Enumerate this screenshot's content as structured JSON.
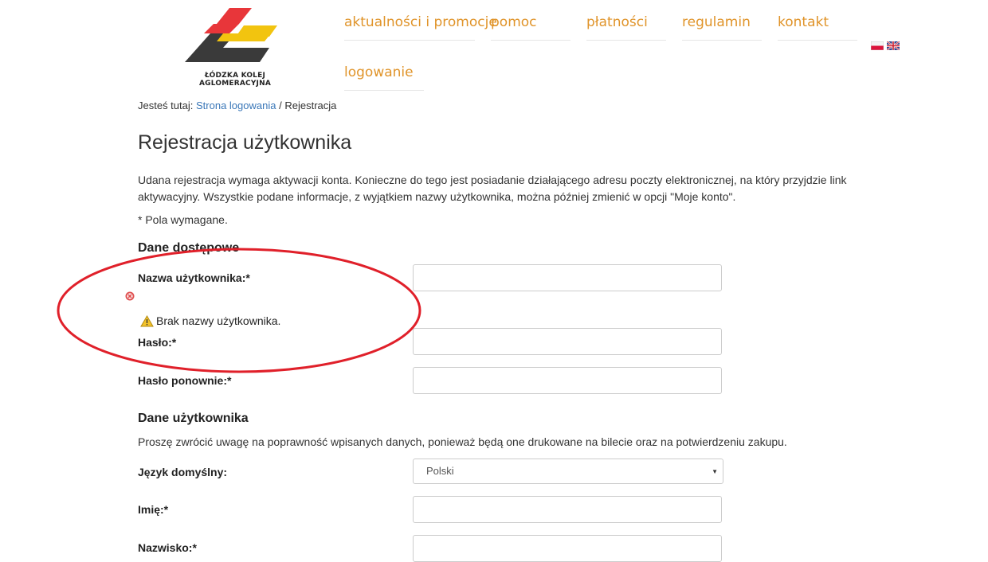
{
  "logo": {
    "text": "ŁÓDZKA KOLEJ AGLOMERACYJNA"
  },
  "nav": {
    "items": [
      "aktualności i promocje",
      "pomoc",
      "płatności",
      "regulamin",
      "kontakt",
      "logowanie"
    ]
  },
  "languages": [
    "pl-flag",
    "en-flag"
  ],
  "breadcrumb": {
    "prefix": "Jesteś tutaj:",
    "link": "Strona logowania",
    "separator": "/",
    "current": "Rejestracja"
  },
  "page_title": "Rejestracja użytkownika",
  "intro": {
    "line1": "Udana rejestracja wymaga aktywacji konta. Konieczne do tego jest posiadanie działającego adresu poczty elektronicznej, na który przyjdzie link",
    "line2": "aktywacyjny. Wszystkie podane informacje, z wyjątkiem nazwy użytkownika, można później zmienić w opcji \"Moje konto\".",
    "required_note": "* Pola wymagane."
  },
  "access_section": {
    "title": "Dane dostępowe",
    "username_label": "Nazwa użytkownika:*",
    "username_error": "Brak nazwy użytkownika.",
    "password_label": "Hasło:*",
    "password_repeat_label": "Hasło ponownie:*"
  },
  "user_section": {
    "title": "Dane użytkownika",
    "note": "Proszę zwrócić uwagę na poprawność wpisanych danych, ponieważ będą one drukowane na bilecie oraz na potwierdzeniu zakupu.",
    "language_label": "Język domyślny:",
    "language_value": "Polski",
    "firstname_label": "Imię:*",
    "lastname_label": "Nazwisko:*"
  },
  "colors": {
    "nav": "#e0942a",
    "link": "#3a77b8",
    "annotation": "#e0202a"
  }
}
